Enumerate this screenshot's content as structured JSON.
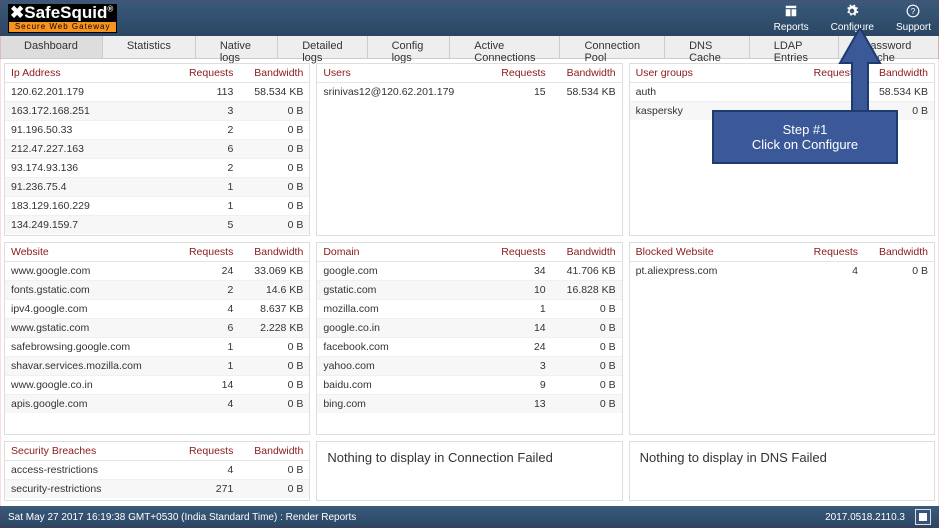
{
  "brand": {
    "name_html": "SafeSquid",
    "reg": "®",
    "tagline": "Secure Web Gateway"
  },
  "top_actions": {
    "reports": "Reports",
    "configure": "Configure",
    "support": "Support"
  },
  "tabs": [
    "Dashboard",
    "Statistics",
    "Native logs",
    "Detailed logs",
    "Config logs",
    "Active Connections",
    "Connection Pool",
    "DNS Cache",
    "LDAP Entries",
    "Password Cache"
  ],
  "panels": {
    "ip": {
      "title": "Ip Address",
      "req": "Requests",
      "bw": "Bandwidth",
      "rows": [
        {
          "n": "120.62.201.179",
          "r": "113",
          "b": "58.534 KB"
        },
        {
          "n": "163.172.168.251",
          "r": "3",
          "b": "0 B"
        },
        {
          "n": "91.196.50.33",
          "r": "2",
          "b": "0 B"
        },
        {
          "n": "212.47.227.163",
          "r": "6",
          "b": "0 B"
        },
        {
          "n": "93.174.93.136",
          "r": "2",
          "b": "0 B"
        },
        {
          "n": "91.236.75.4",
          "r": "1",
          "b": "0 B"
        },
        {
          "n": "183.129.160.229",
          "r": "1",
          "b": "0 B"
        },
        {
          "n": "134.249.159.7",
          "r": "5",
          "b": "0 B"
        }
      ]
    },
    "users": {
      "title": "Users",
      "req": "Requests",
      "bw": "Bandwidth",
      "rows": [
        {
          "n": "srinivas12@120.62.201.179",
          "r": "15",
          "b": "58.534 KB"
        }
      ]
    },
    "groups": {
      "title": "User groups",
      "req": "Requests",
      "bw": "Bandwidth",
      "rows": [
        {
          "n": "auth",
          "r": "",
          "b": "58.534 KB"
        },
        {
          "n": "kaspersky",
          "r": "",
          "b": "0 B"
        }
      ]
    },
    "website": {
      "title": "Website",
      "req": "Requests",
      "bw": "Bandwidth",
      "rows": [
        {
          "n": "www.google.com",
          "r": "24",
          "b": "33.069 KB"
        },
        {
          "n": "fonts.gstatic.com",
          "r": "2",
          "b": "14.6 KB"
        },
        {
          "n": "ipv4.google.com",
          "r": "4",
          "b": "8.637 KB"
        },
        {
          "n": "www.gstatic.com",
          "r": "6",
          "b": "2.228 KB"
        },
        {
          "n": "safebrowsing.google.com",
          "r": "1",
          "b": "0 B"
        },
        {
          "n": "shavar.services.mozilla.com",
          "r": "1",
          "b": "0 B"
        },
        {
          "n": "www.google.co.in",
          "r": "14",
          "b": "0 B"
        },
        {
          "n": "apis.google.com",
          "r": "4",
          "b": "0 B"
        }
      ]
    },
    "domain": {
      "title": "Domain",
      "req": "Requests",
      "bw": "Bandwidth",
      "rows": [
        {
          "n": "google.com",
          "r": "34",
          "b": "41.706 KB"
        },
        {
          "n": "gstatic.com",
          "r": "10",
          "b": "16.828 KB"
        },
        {
          "n": "mozilla.com",
          "r": "1",
          "b": "0 B"
        },
        {
          "n": "google.co.in",
          "r": "14",
          "b": "0 B"
        },
        {
          "n": "facebook.com",
          "r": "24",
          "b": "0 B"
        },
        {
          "n": "yahoo.com",
          "r": "3",
          "b": "0 B"
        },
        {
          "n": "baidu.com",
          "r": "9",
          "b": "0 B"
        },
        {
          "n": "bing.com",
          "r": "13",
          "b": "0 B"
        }
      ]
    },
    "blocked": {
      "title": "Blocked Website",
      "req": "Requests",
      "bw": "Bandwidth",
      "rows": [
        {
          "n": "pt.aliexpress.com",
          "r": "4",
          "b": "0 B"
        }
      ]
    },
    "breach": {
      "title": "Security Breaches",
      "req": "Requests",
      "bw": "Bandwidth",
      "rows": [
        {
          "n": "access-restrictions",
          "r": "4",
          "b": "0 B"
        },
        {
          "n": "security-restrictions",
          "r": "271",
          "b": "0 B"
        }
      ]
    },
    "connfail": {
      "empty": "Nothing to display in Connection Failed"
    },
    "dnsfail": {
      "empty": "Nothing to display in DNS Failed"
    }
  },
  "callout": {
    "line1": "Step #1",
    "line2": "Click on Configure"
  },
  "footer": {
    "status": "Sat May 27 2017 16:19:38 GMT+0530 (India Standard Time) : Render Reports",
    "version": "2017.0518.2110.3"
  }
}
